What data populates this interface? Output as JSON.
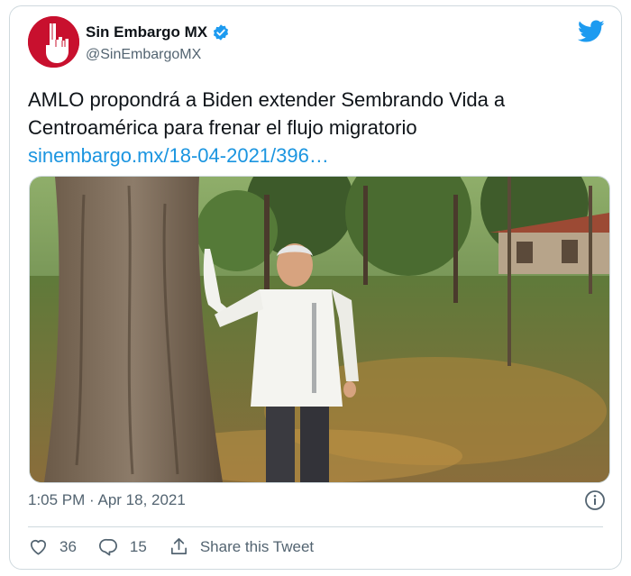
{
  "account": {
    "display_name": "Sin Embargo MX",
    "handle": "@SinEmbargoMX"
  },
  "tweet": {
    "text": "AMLO propondrá a Biden extender Sembrando Vida a Centroamérica para frenar el flujo migratorio",
    "link": "sinembargo.mx/18-04-2021/396…",
    "timestamp": "1:05 PM · Apr 18, 2021"
  },
  "actions": {
    "likes": "36",
    "replies": "15",
    "share_label": "Share this Tweet"
  },
  "icons": [
    "twitter-bird-icon",
    "verified-badge-icon",
    "info-icon",
    "heart-icon",
    "reply-icon",
    "share-icon"
  ],
  "colors": {
    "link": "#1b95e0",
    "verified": "#1d9bf0",
    "avatar_bg": "#c8102e",
    "muted": "#536471"
  }
}
